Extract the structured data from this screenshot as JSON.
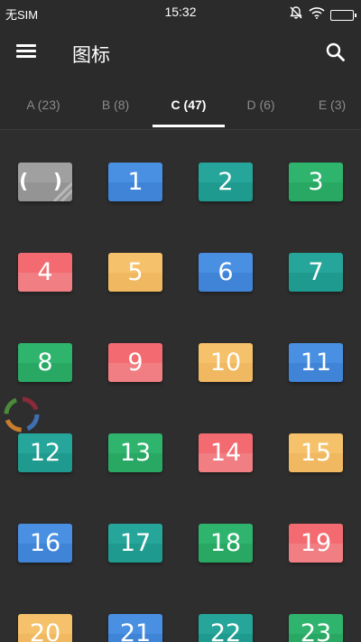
{
  "status_bar": {
    "carrier": "无SIM",
    "time": "15:32"
  },
  "app_bar": {
    "title": "图标",
    "menu_icon": "hamburger-menu-icon",
    "search_icon": "search-icon"
  },
  "tabs": [
    {
      "label": "A (23)"
    },
    {
      "label": "B (8)"
    },
    {
      "label": "C (47)",
      "active": true
    },
    {
      "label": "D (6)"
    },
    {
      "label": "E (3)"
    }
  ],
  "palette": {
    "gray": [
      "#a0a0a0",
      "#949494"
    ],
    "blue": [
      "#4a90e2",
      "#3f84d6"
    ],
    "teal": [
      "#26a69a",
      "#1f9a8e"
    ],
    "green": [
      "#2fb46e",
      "#28a863"
    ],
    "red": [
      "#f36b70",
      "#f07e82"
    ],
    "yellow": [
      "#f5c26b",
      "#f0b860"
    ]
  },
  "icons": [
    {
      "label": "( )",
      "color": "gray"
    },
    {
      "label": "1",
      "color": "blue"
    },
    {
      "label": "2",
      "color": "teal"
    },
    {
      "label": "3",
      "color": "green"
    },
    {
      "label": "4",
      "color": "red"
    },
    {
      "label": "5",
      "color": "yellow"
    },
    {
      "label": "6",
      "color": "blue"
    },
    {
      "label": "7",
      "color": "teal"
    },
    {
      "label": "8",
      "color": "green"
    },
    {
      "label": "9",
      "color": "red"
    },
    {
      "label": "10",
      "color": "yellow"
    },
    {
      "label": "11",
      "color": "blue"
    },
    {
      "label": "12",
      "color": "teal"
    },
    {
      "label": "13",
      "color": "green"
    },
    {
      "label": "14",
      "color": "red"
    },
    {
      "label": "15",
      "color": "yellow"
    },
    {
      "label": "16",
      "color": "blue"
    },
    {
      "label": "17",
      "color": "teal"
    },
    {
      "label": "18",
      "color": "green"
    },
    {
      "label": "19",
      "color": "red"
    },
    {
      "label": "20",
      "color": "yellow"
    },
    {
      "label": "21",
      "color": "blue"
    },
    {
      "label": "22",
      "color": "teal"
    },
    {
      "label": "23",
      "color": "green"
    }
  ]
}
